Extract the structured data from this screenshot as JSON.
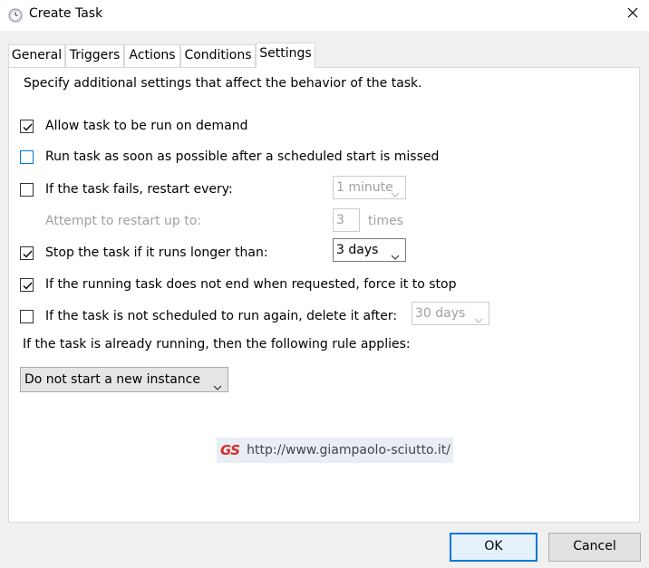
{
  "window": {
    "title": "Create Task",
    "icon": "clock-icon",
    "close_icon": "close-icon"
  },
  "tabs": [
    {
      "label": "General",
      "active": false
    },
    {
      "label": "Triggers",
      "active": false
    },
    {
      "label": "Actions",
      "active": false
    },
    {
      "label": "Conditions",
      "active": false
    },
    {
      "label": "Settings",
      "active": true
    }
  ],
  "settings": {
    "description": "Specify additional settings that affect the behavior of the task.",
    "allow_on_demand": {
      "label": "Allow task to be run on demand",
      "checked": true
    },
    "run_asap": {
      "label": "Run task as soon as possible after a scheduled start is missed",
      "checked": false
    },
    "restart_on_fail": {
      "label": "If the task fails, restart every:",
      "checked": false,
      "value": "1 minute",
      "enabled": false
    },
    "restart_attempts": {
      "label": "Attempt to restart up to:",
      "value": "3",
      "unit": "times",
      "enabled": false
    },
    "stop_if_longer": {
      "label": "Stop the task if it runs longer than:",
      "checked": true,
      "value": "3 days"
    },
    "force_stop": {
      "label": "If the running task does not end when requested, force it to stop",
      "checked": true
    },
    "delete_after": {
      "label": "If the task is not scheduled to run again, delete it after:",
      "checked": false,
      "value": "30 days",
      "enabled": false
    },
    "running_rule_label": "If the task is already running, then the following rule applies:",
    "running_rule_value": "Do not start a new instance"
  },
  "watermark": {
    "logo": "GS",
    "url": "http://www.giampaolo-sciutto.it/"
  },
  "buttons": {
    "ok": "OK",
    "cancel": "Cancel"
  },
  "colors": {
    "accent": "#0078d7",
    "logo_red": "#d62b2b"
  }
}
